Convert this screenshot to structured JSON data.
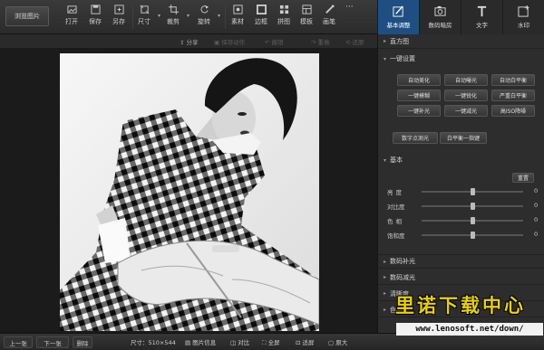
{
  "toolbar": {
    "browse_label": "浏览图片",
    "tools": [
      {
        "label": "打开",
        "icon": "open-icon"
      },
      {
        "label": "保存",
        "icon": "save-icon"
      },
      {
        "label": "另存",
        "icon": "save-as-icon"
      },
      {
        "label": "尺寸",
        "icon": "resize-icon"
      },
      {
        "label": "裁剪",
        "icon": "crop-icon"
      },
      {
        "label": "旋转",
        "icon": "rotate-icon"
      },
      {
        "label": "素材",
        "icon": "material-icon"
      },
      {
        "label": "边框",
        "icon": "frame-icon"
      },
      {
        "label": "拼图",
        "icon": "collage-icon"
      },
      {
        "label": "模板",
        "icon": "template-icon"
      },
      {
        "label": "画笔",
        "icon": "brush-icon"
      }
    ],
    "more_label": "···"
  },
  "panel_tabs": [
    {
      "label": "基本调整",
      "icon": "adjust-icon",
      "active": true
    },
    {
      "label": "数码暗房",
      "icon": "camera-icon",
      "active": false
    },
    {
      "label": "文字",
      "icon": "text-icon",
      "active": false
    },
    {
      "label": "水印",
      "icon": "watermark-icon",
      "active": false
    }
  ],
  "subbar": {
    "share": "分享",
    "save_action": "保存动作",
    "undo": "撤销",
    "redo": "重做",
    "restore": "还原"
  },
  "right_panel": {
    "histogram": "直方图",
    "one_click": "一键设置",
    "one_click_buttons": [
      "自动美化",
      "自动曝光",
      "自动白平衡",
      "一键模糊",
      "一键锐化",
      "严重白平衡",
      "一键补光",
      "一键减光",
      "高ISO降噪"
    ],
    "extra_buttons": [
      "数字点测光",
      "白平衡一指键"
    ],
    "basic": "基本",
    "reset": "重置",
    "sliders": [
      {
        "label": "亮度",
        "value": "0",
        "level": 0.5
      },
      {
        "label": "对比度",
        "value": "0",
        "level": 0.5
      },
      {
        "label": "色相",
        "value": "0",
        "level": 0.5
      },
      {
        "label": "饱和度",
        "value": "0",
        "level": 0.5
      }
    ],
    "sections": [
      "数码补光",
      "数码减光",
      "清晰度",
      "色阶"
    ]
  },
  "statusbar": {
    "prev": "上一张",
    "next": "下一张",
    "delete": "删除",
    "size": "尺寸：510×544",
    "info": "图片信息",
    "compare": "对比",
    "fullscreen": "全屏",
    "fit": "适屏",
    "zoom": "原大"
  },
  "watermark": {
    "text": "里诺下载中心",
    "url": "www.lenosoft.net/down/"
  },
  "colors": {
    "accent": "#1f4f82",
    "watermark": "#e8d200"
  }
}
